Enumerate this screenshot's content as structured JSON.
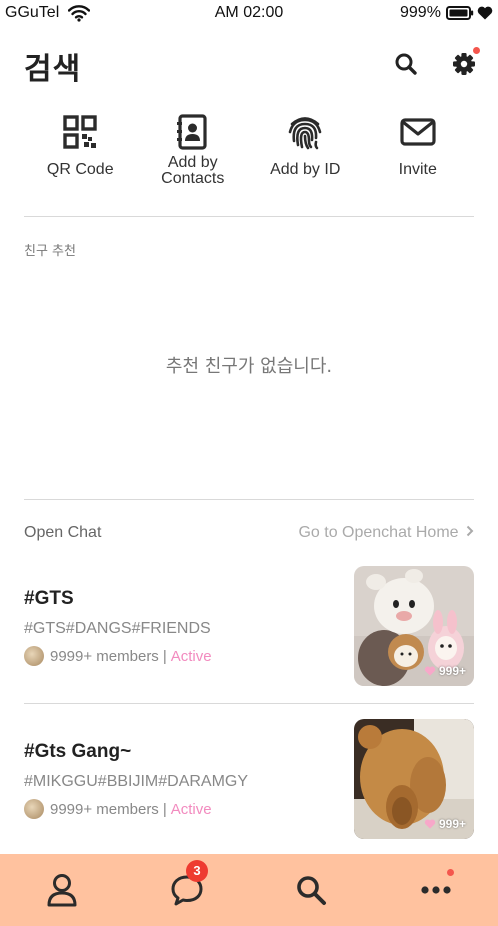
{
  "status_bar": {
    "carrier": "GGuTel",
    "time": "AM 02:00",
    "battery": "999%",
    "icons": [
      "wifi-icon",
      "battery-icon",
      "heart-icon"
    ]
  },
  "header": {
    "title": "검색",
    "icons": [
      "search-icon",
      "gear-icon"
    ]
  },
  "actions": [
    {
      "label": "QR Code",
      "icon": "qr-code-icon"
    },
    {
      "label": "Add by Contacts",
      "icon": "contact-book-icon"
    },
    {
      "label": "Add by ID",
      "icon": "fingerprint-icon"
    },
    {
      "label": "Invite",
      "icon": "envelope-icon"
    }
  ],
  "recommend": {
    "label": "친구 추천",
    "empty_text": "추천 친구가 없습니다."
  },
  "open_chat": {
    "label": "Open Chat",
    "link": "Go to Openchat Home",
    "link_icon": "chevron-right-icon",
    "items": [
      {
        "title": "#GTS",
        "tags": "#GTS#DANGS#FRIENDS",
        "members": "9999+ members",
        "separator": "|",
        "status": "Active",
        "likes": "999+"
      },
      {
        "title": "#Gts Gang~",
        "tags": "#MIKGGU#BBIJIM#DARAMGY",
        "members": "9999+ members",
        "separator": "|",
        "status": "Active",
        "likes": "999+"
      }
    ]
  },
  "tabbar": {
    "tabs": [
      "person-icon",
      "chat-bubble-icon",
      "search-icon",
      "more-icon"
    ],
    "chat_badge": "3"
  },
  "colors": {
    "tabbar_bg": "#ffc29f",
    "active": "#f28bbf",
    "badge": "#ee3b30"
  }
}
